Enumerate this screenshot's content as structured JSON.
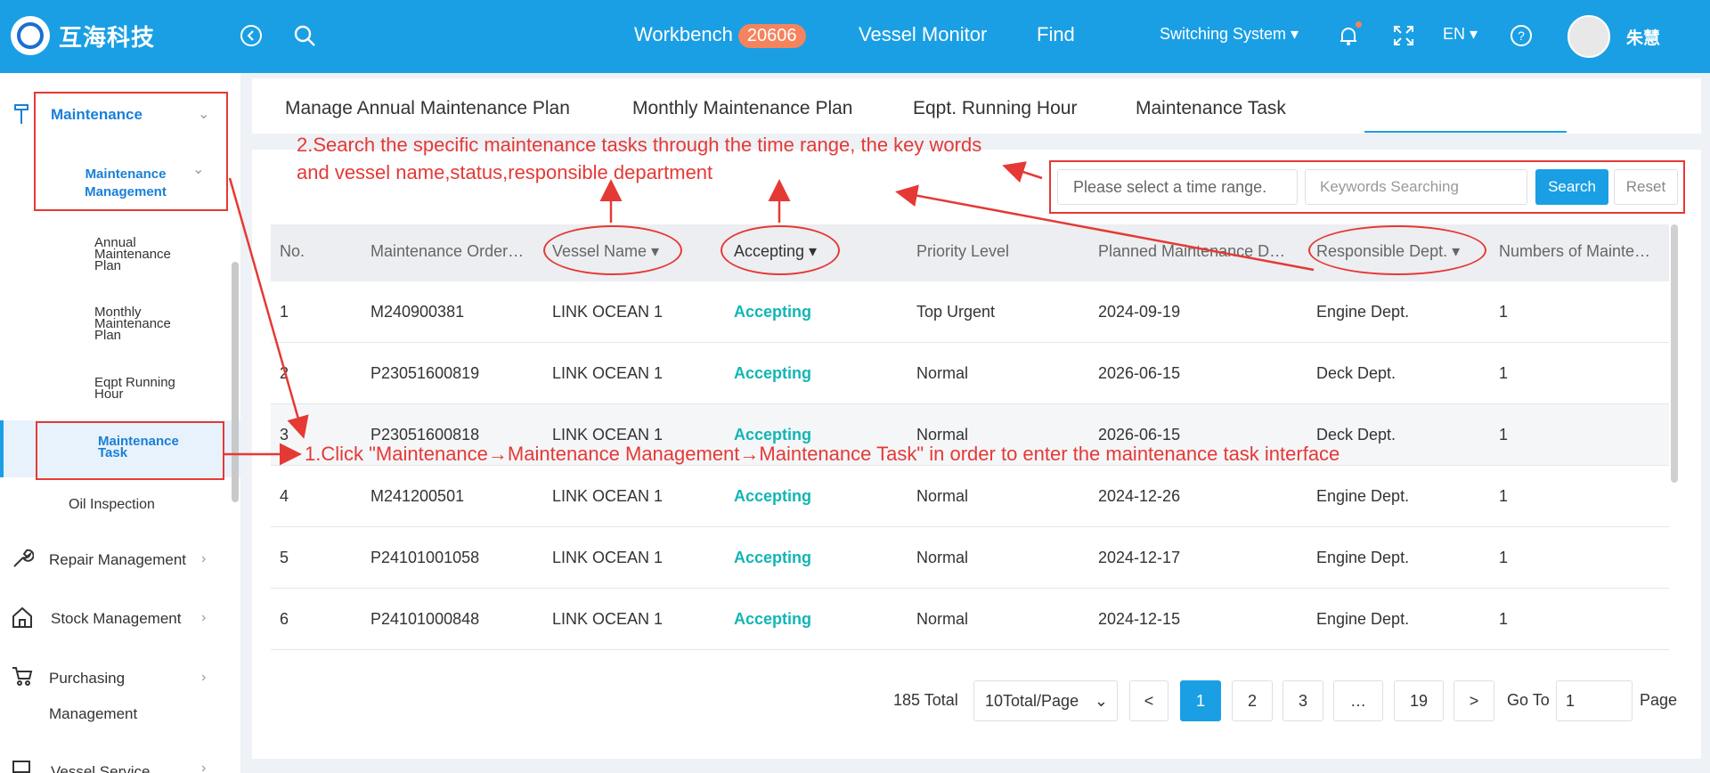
{
  "header": {
    "brand": "互海科技",
    "nav": {
      "workbench": "Workbench",
      "workbench_badge": "20606",
      "vessel_monitor": "Vessel Monitor",
      "find": "Find"
    },
    "switching_system": "Switching System ▾",
    "language": "EN ▾",
    "username": "朱慧"
  },
  "sidebar": {
    "maintenance": "Maintenance",
    "maintenance_management": "Maintenance Management",
    "annual_plan": "Annual Maintenance Plan",
    "monthly_plan": "Monthly Maintenance Plan",
    "eqpt_running_hour": "Eqpt Running Hour",
    "maintenance_task": "Maintenance Task",
    "oil_inspection": "Oil Inspection",
    "repair_management": "Repair Management",
    "stock_management": "Stock Management",
    "purchasing": "Purchasing",
    "purchasing_management": "Management",
    "vessel_service": "Vessel Service"
  },
  "tabs": [
    "Manage Annual Maintenance Plan",
    "Monthly Maintenance Plan",
    "Eqpt. Running Hour",
    "Maintenance Task"
  ],
  "filters": {
    "time_placeholder": "Please select a time range.",
    "keyword_placeholder": "Keywords Searching",
    "search": "Search",
    "reset": "Reset"
  },
  "table": {
    "headers": [
      "No.",
      "Maintenance Order…",
      "Vessel Name ▾",
      "Accepting ▾",
      "Priority Level",
      "Planned Maintenance D…",
      "Responsible Dept. ▾",
      "Numbers of Mainte…"
    ],
    "rows": [
      [
        "1",
        "M240900381",
        "LINK OCEAN 1",
        "Accepting",
        "Top Urgent",
        "2024-09-19",
        "Engine Dept.",
        "1"
      ],
      [
        "2",
        "P23051600819",
        "LINK OCEAN 1",
        "Accepting",
        "Normal",
        "2026-06-15",
        "Deck Dept.",
        "1"
      ],
      [
        "3",
        "P23051600818",
        "LINK OCEAN 1",
        "Accepting",
        "Normal",
        "2026-06-15",
        "Deck Dept.",
        "1"
      ],
      [
        "4",
        "M241200501",
        "LINK OCEAN 1",
        "Accepting",
        "Normal",
        "2024-12-26",
        "Engine Dept.",
        "1"
      ],
      [
        "5",
        "P24101001058",
        "LINK OCEAN 1",
        "Accepting",
        "Normal",
        "2024-12-17",
        "Engine Dept.",
        "1"
      ],
      [
        "6",
        "P24101000848",
        "LINK OCEAN 1",
        "Accepting",
        "Normal",
        "2024-12-15",
        "Engine Dept.",
        "1"
      ]
    ]
  },
  "pagination": {
    "total": "185 Total",
    "page_size": "10Total/Page",
    "prev": "<",
    "pages": [
      "1",
      "2",
      "3",
      "…",
      "19"
    ],
    "next": ">",
    "goto_label": "Go To",
    "goto_value": "1",
    "page_label": "Page"
  },
  "annotations": {
    "step2_line1": "2.Search the specific maintenance tasks through the time range, the key words",
    "step2_line2": "and vessel name,status,responsible department",
    "step1": "1.Click \"Maintenance→Maintenance Management→Maintenance Task\" in order to enter the maintenance task interface"
  },
  "colors": {
    "brand_blue": "#1a9fe4",
    "accent_teal": "#13b5b5",
    "annotation_red": "#e53935",
    "badge_orange": "#f5835d"
  }
}
